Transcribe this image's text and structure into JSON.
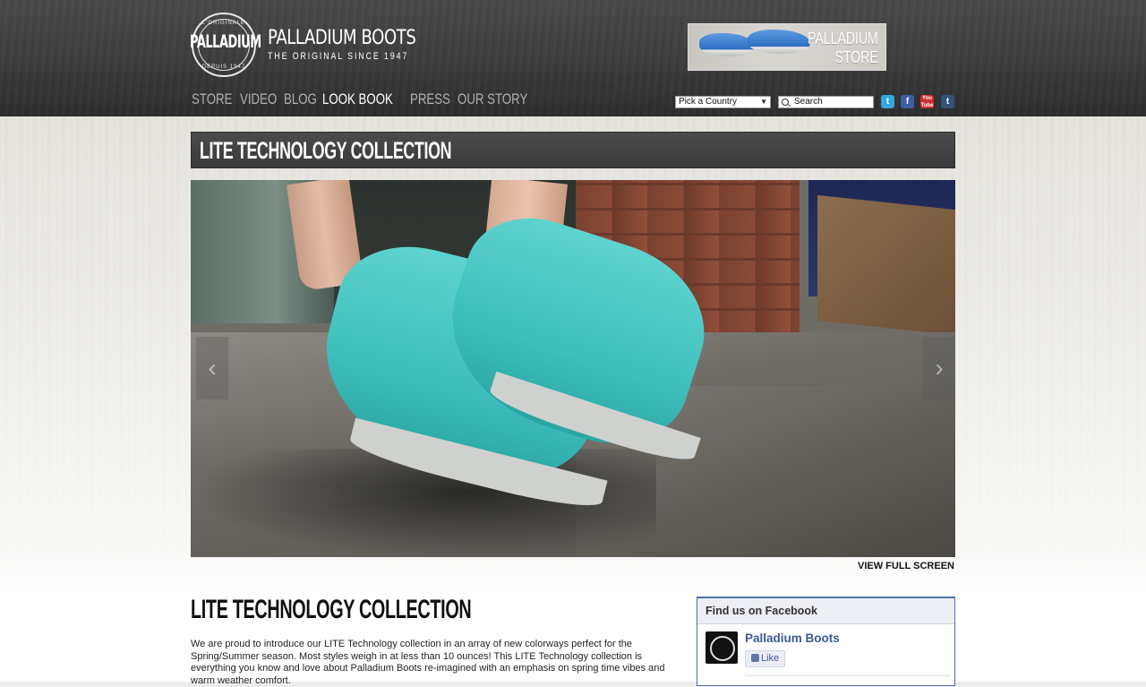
{
  "header": {
    "logo": {
      "word": "PALLADIUM",
      "arc_top": "L'ORIGINALE",
      "arc_bottom": "DEPUIS 1947"
    },
    "brand_name": "PALLADIUM BOOTS",
    "brand_tagline": "THE ORIGINAL SINCE 1947",
    "store_banner": "PALLADIUM\nSTORE",
    "nav": [
      {
        "label": "STORE",
        "active": false
      },
      {
        "label": "VIDEO",
        "active": false
      },
      {
        "label": "BLOG",
        "active": false
      },
      {
        "label": "LOOK BOOK",
        "active": true
      },
      {
        "label": "PRESS",
        "active": false
      },
      {
        "label": "OUR STORY",
        "active": false
      }
    ],
    "country_select": "Pick a Country",
    "search_placeholder": "Search",
    "social": {
      "twitter": "t",
      "facebook": "f",
      "youtube": "You Tube",
      "tumblr": "t"
    }
  },
  "collection": {
    "title_bar": "LITE TECHNOLOGY COLLECTION",
    "fullscreen_label": "VIEW FULL SCREEN",
    "prev_arrow": "‹",
    "next_arrow": "›"
  },
  "content": {
    "title": "LITE TECHNOLOGY COLLECTION",
    "body": "We are proud to introduce our LITE Technology collection in an array of new colorways perfect for the Spring/Summer season. Most styles weigh in at less than 10 ounces! This LITE Technology collection is everything you know and love about Palladium Boots re-imagined with an emphasis on spring time vibes and warm weather comfort."
  },
  "facebook": {
    "header": "Find us on Facebook",
    "page_name": "Palladium Boots",
    "like_label": "Like"
  },
  "colors": {
    "header_bg": "#3c3c3c",
    "nav_active": "#ffffff",
    "nav_inactive": "#b0b0b0",
    "facebook_blue": "#3b5998",
    "boot_teal": "#3ebfbc"
  }
}
